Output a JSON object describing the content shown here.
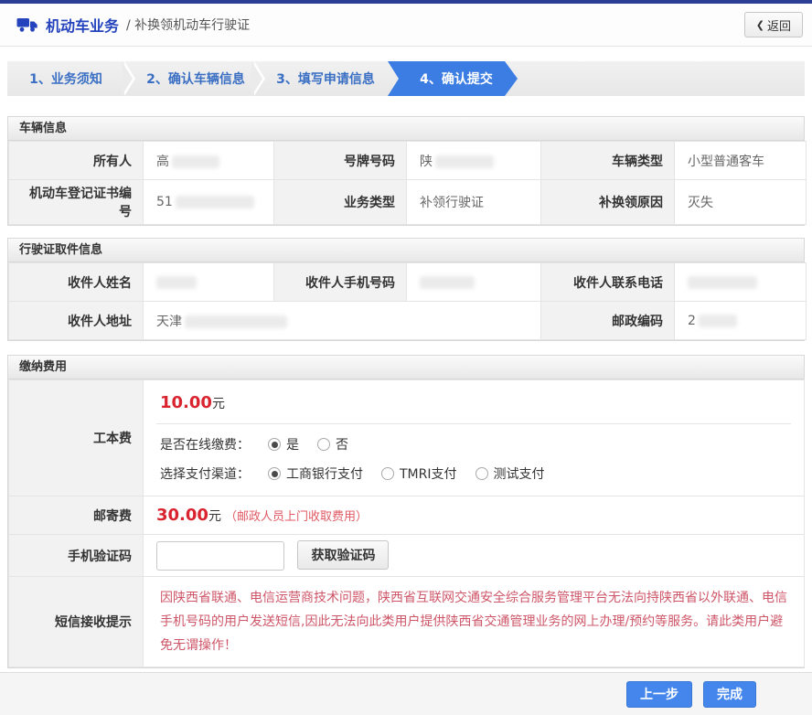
{
  "header": {
    "title": "机动车业务",
    "subtitle": "/ 补换领机动车行驶证",
    "back_icon": "❮",
    "back_label": "返回"
  },
  "steps": [
    {
      "label": "1、业务须知",
      "active": false
    },
    {
      "label": "2、确认车辆信息",
      "active": false
    },
    {
      "label": "3、填写申请信息",
      "active": false
    },
    {
      "label": "4、确认提交",
      "active": true
    }
  ],
  "vehicle_info": {
    "title": "车辆信息",
    "rows": [
      [
        {
          "label": "所有人",
          "value": "高",
          "redacted": true
        },
        {
          "label": "号牌号码",
          "value": "陕",
          "redacted": true
        },
        {
          "label": "车辆类型",
          "value": "小型普通客车",
          "redacted": false
        }
      ],
      [
        {
          "label": "机动车登记证书编号",
          "value": "51",
          "redacted": true
        },
        {
          "label": "业务类型",
          "value": "补领行驶证",
          "redacted": false
        },
        {
          "label": "补换领原因",
          "value": "灭失",
          "redacted": false
        }
      ]
    ]
  },
  "pickup_info": {
    "title": "行驶证取件信息",
    "row1": [
      {
        "label": "收件人姓名",
        "value": "",
        "redacted": true
      },
      {
        "label": "收件人手机号码",
        "value": "",
        "redacted": true
      },
      {
        "label": "收件人联系电话",
        "value": "",
        "redacted": true
      }
    ],
    "row2": [
      {
        "label": "收件人地址",
        "value": "天津",
        "redacted": true
      },
      {
        "label": "邮政编码",
        "value": "2",
        "redacted": true
      }
    ]
  },
  "payment": {
    "title": "缴纳费用",
    "gongben": {
      "label": "工本费",
      "amount": "10.00",
      "unit": "元",
      "online_question": "是否在线缴费：",
      "online_options": [
        {
          "label": "是",
          "checked": true
        },
        {
          "label": "否",
          "checked": false
        }
      ],
      "channel_question": "选择支付渠道：",
      "channel_options": [
        {
          "label": "工商银行支付",
          "checked": true
        },
        {
          "label": "TMRI支付",
          "checked": false
        },
        {
          "label": "测试支付",
          "checked": false
        }
      ]
    },
    "youji": {
      "label": "邮寄费",
      "amount": "30.00",
      "unit": "元",
      "note": "（邮政人员上门收取费用）"
    },
    "captcha": {
      "label": "手机验证码",
      "input_value": "",
      "button_label": "获取验证码"
    },
    "sms": {
      "label": "短信接收提示",
      "text": "因陕西省联通、电信运营商技术问题，陕西省互联网交通安全综合服务管理平台无法向持陕西省以外联通、电信手机号码的用户发送短信,因此无法向此类用户提供陕西省交通管理业务的网上办理/预约等服务。请此类用户避免无谓操作！"
    }
  },
  "footer": {
    "prev_label": "上一步",
    "finish_label": "完成"
  },
  "colors": {
    "accent_blue": "#3b7de2",
    "brand_blue": "#2443bd",
    "fee_red": "#d9232f",
    "warning_red": "#ce5668"
  }
}
